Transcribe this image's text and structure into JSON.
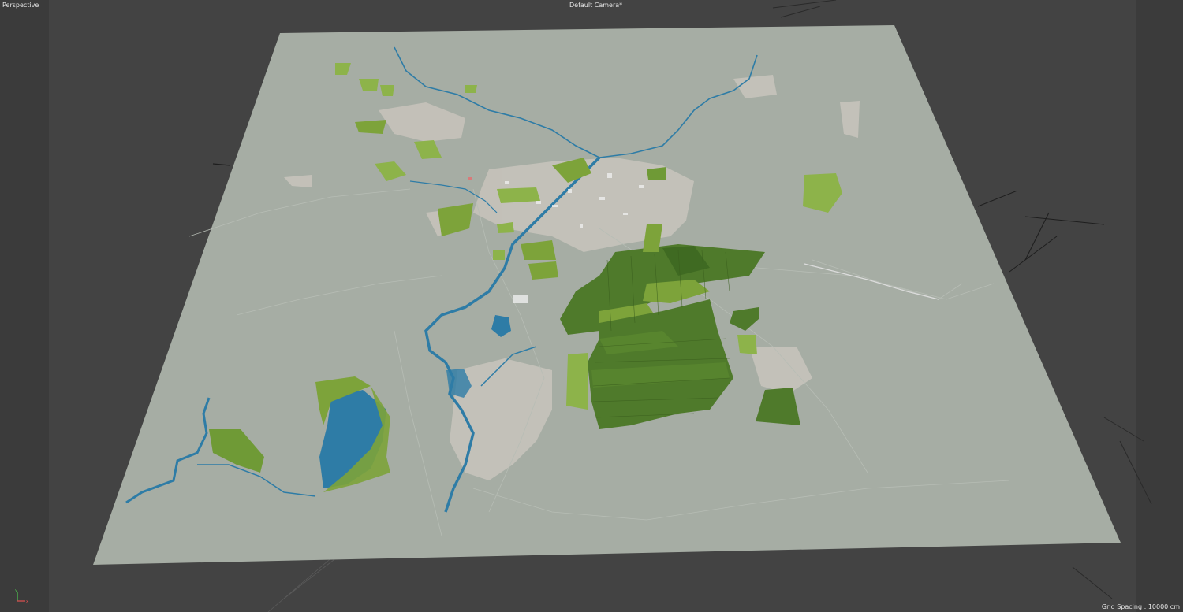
{
  "viewport": {
    "view_label": "Perspective",
    "camera_label": "Default Camera",
    "camera_marker": "*",
    "grid_spacing": "Grid Spacing : 10000 cm"
  },
  "axis_gizmo": {
    "x_label": "x",
    "y_label": "y"
  },
  "colors": {
    "viewport_bg": "#434343",
    "terrain": "#a6ada4",
    "water": "#2e7ca6",
    "forest_light": "#7da33a",
    "forest_dark": "#4f7a2b",
    "urban": "#c7c3bb"
  },
  "icons": [
    "axis-gizmo-icon",
    "camera-marker-icon"
  ]
}
